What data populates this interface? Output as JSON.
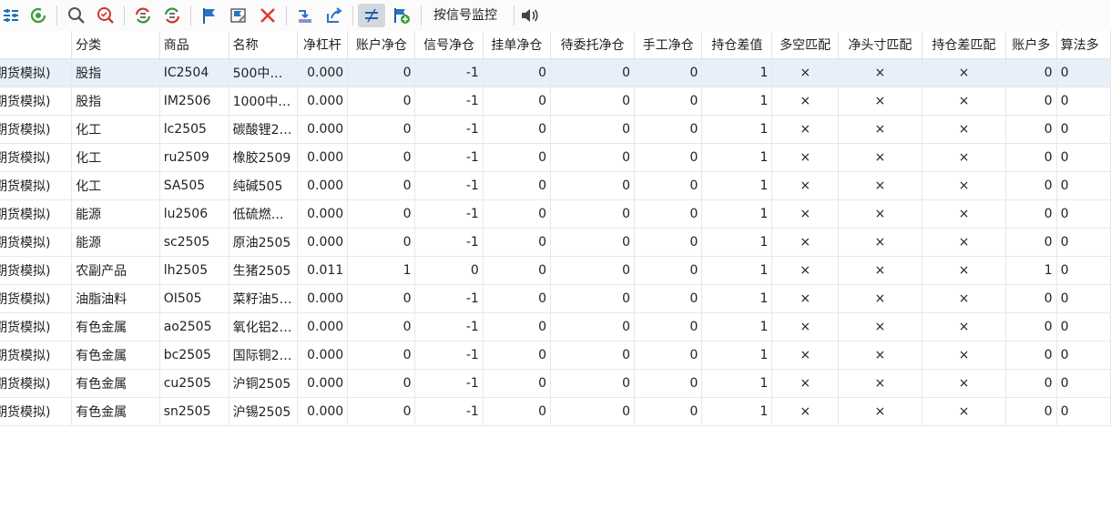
{
  "toolbar": {
    "monitor_label": "按信号监控",
    "icons": [
      "layout-icon",
      "refresh-icon",
      "search-icon",
      "search-clear-icon",
      "sync-red-green-icon",
      "sync-green-red-icon",
      "flag-icon",
      "flag-edit-icon",
      "close-icon",
      "import-icon",
      "export-icon",
      "net-compare-icon",
      "flag-add-icon",
      "sound-icon"
    ]
  },
  "columns": [
    "",
    "分类",
    "商品",
    "名称",
    "净杠杆",
    "账户净仓",
    "信号净仓",
    "挂单净仓",
    "待委托净仓",
    "手工净仓",
    "持仓差值",
    "多空匹配",
    "净头寸匹配",
    "持仓差匹配",
    "账户多",
    "算法多"
  ],
  "rows": [
    {
      "account": "期货模拟)",
      "category": "股指",
      "product": "IC2504",
      "name": "500中…",
      "leverage": "0.000",
      "acct_net": "0",
      "signal_net": "-1",
      "pending_net": "0",
      "to_order_net": "0",
      "manual_net": "0",
      "diff": "1",
      "ls_match": "×",
      "net_match": "×",
      "diff_match": "×",
      "acct_long": "0",
      "algo_long": "0"
    },
    {
      "account": "期货模拟)",
      "category": "股指",
      "product": "IM2506",
      "name": "1000中…",
      "leverage": "0.000",
      "acct_net": "0",
      "signal_net": "-1",
      "pending_net": "0",
      "to_order_net": "0",
      "manual_net": "0",
      "diff": "1",
      "ls_match": "×",
      "net_match": "×",
      "diff_match": "×",
      "acct_long": "0",
      "algo_long": "0"
    },
    {
      "account": "期货模拟)",
      "category": "化工",
      "product": "lc2505",
      "name": "碳酸锂2…",
      "leverage": "0.000",
      "acct_net": "0",
      "signal_net": "-1",
      "pending_net": "0",
      "to_order_net": "0",
      "manual_net": "0",
      "diff": "1",
      "ls_match": "×",
      "net_match": "×",
      "diff_match": "×",
      "acct_long": "0",
      "algo_long": "0"
    },
    {
      "account": "期货模拟)",
      "category": "化工",
      "product": "ru2509",
      "name": "橡胶2509",
      "leverage": "0.000",
      "acct_net": "0",
      "signal_net": "-1",
      "pending_net": "0",
      "to_order_net": "0",
      "manual_net": "0",
      "diff": "1",
      "ls_match": "×",
      "net_match": "×",
      "diff_match": "×",
      "acct_long": "0",
      "algo_long": "0"
    },
    {
      "account": "期货模拟)",
      "category": "化工",
      "product": "SA505",
      "name": "纯碱505",
      "leverage": "0.000",
      "acct_net": "0",
      "signal_net": "-1",
      "pending_net": "0",
      "to_order_net": "0",
      "manual_net": "0",
      "diff": "1",
      "ls_match": "×",
      "net_match": "×",
      "diff_match": "×",
      "acct_long": "0",
      "algo_long": "0"
    },
    {
      "account": "期货模拟)",
      "category": "能源",
      "product": "lu2506",
      "name": "低硫燃…",
      "leverage": "0.000",
      "acct_net": "0",
      "signal_net": "-1",
      "pending_net": "0",
      "to_order_net": "0",
      "manual_net": "0",
      "diff": "1",
      "ls_match": "×",
      "net_match": "×",
      "diff_match": "×",
      "acct_long": "0",
      "algo_long": "0"
    },
    {
      "account": "期货模拟)",
      "category": "能源",
      "product": "sc2505",
      "name": "原油2505",
      "leverage": "0.000",
      "acct_net": "0",
      "signal_net": "-1",
      "pending_net": "0",
      "to_order_net": "0",
      "manual_net": "0",
      "diff": "1",
      "ls_match": "×",
      "net_match": "×",
      "diff_match": "×",
      "acct_long": "0",
      "algo_long": "0"
    },
    {
      "account": "期货模拟)",
      "category": "农副产品",
      "product": "lh2505",
      "name": "生猪2505",
      "leverage": "0.011",
      "acct_net": "1",
      "signal_net": "0",
      "pending_net": "0",
      "to_order_net": "0",
      "manual_net": "0",
      "diff": "1",
      "ls_match": "×",
      "net_match": "×",
      "diff_match": "×",
      "acct_long": "1",
      "algo_long": "0"
    },
    {
      "account": "期货模拟)",
      "category": "油脂油料",
      "product": "OI505",
      "name": "菜籽油5…",
      "leverage": "0.000",
      "acct_net": "0",
      "signal_net": "-1",
      "pending_net": "0",
      "to_order_net": "0",
      "manual_net": "0",
      "diff": "1",
      "ls_match": "×",
      "net_match": "×",
      "diff_match": "×",
      "acct_long": "0",
      "algo_long": "0"
    },
    {
      "account": "期货模拟)",
      "category": "有色金属",
      "product": "ao2505",
      "name": "氧化铝2…",
      "leverage": "0.000",
      "acct_net": "0",
      "signal_net": "-1",
      "pending_net": "0",
      "to_order_net": "0",
      "manual_net": "0",
      "diff": "1",
      "ls_match": "×",
      "net_match": "×",
      "diff_match": "×",
      "acct_long": "0",
      "algo_long": "0"
    },
    {
      "account": "期货模拟)",
      "category": "有色金属",
      "product": "bc2505",
      "name": "国际铜2…",
      "leverage": "0.000",
      "acct_net": "0",
      "signal_net": "-1",
      "pending_net": "0",
      "to_order_net": "0",
      "manual_net": "0",
      "diff": "1",
      "ls_match": "×",
      "net_match": "×",
      "diff_match": "×",
      "acct_long": "0",
      "algo_long": "0"
    },
    {
      "account": "期货模拟)",
      "category": "有色金属",
      "product": "cu2505",
      "name": "沪铜2505",
      "leverage": "0.000",
      "acct_net": "0",
      "signal_net": "-1",
      "pending_net": "0",
      "to_order_net": "0",
      "manual_net": "0",
      "diff": "1",
      "ls_match": "×",
      "net_match": "×",
      "diff_match": "×",
      "acct_long": "0",
      "algo_long": "0"
    },
    {
      "account": "期货模拟)",
      "category": "有色金属",
      "product": "sn2505",
      "name": "沪锡2505",
      "leverage": "0.000",
      "acct_net": "0",
      "signal_net": "-1",
      "pending_net": "0",
      "to_order_net": "0",
      "manual_net": "0",
      "diff": "1",
      "ls_match": "×",
      "net_match": "×",
      "diff_match": "×",
      "acct_long": "0",
      "algo_long": "0"
    }
  ]
}
